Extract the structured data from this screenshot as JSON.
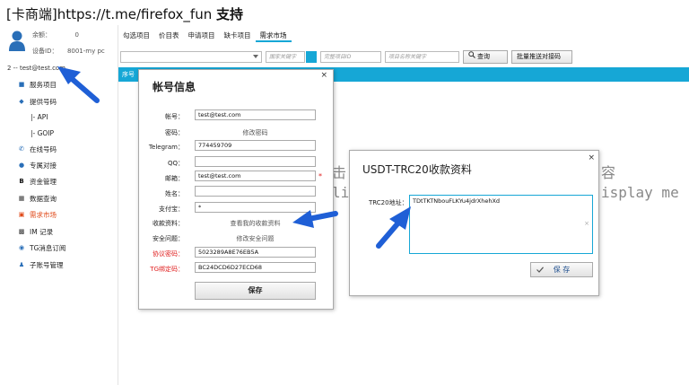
{
  "app": {
    "title_prefix": "[卡商端]",
    "title_url": "https://t.me/firefox_fun",
    "title_suffix": "支持"
  },
  "account": {
    "balance_label": "余额：",
    "balance_value": "0",
    "device_label": "设备ID：",
    "device_value": "8001-my pc",
    "user_line": "2 -- test@test.com"
  },
  "sidebar": {
    "items": [
      {
        "label": "服务项目",
        "icon": "shield-icon"
      },
      {
        "label": "提供号码",
        "icon": "diamond-icon"
      },
      {
        "label": "|- API",
        "icon": ""
      },
      {
        "label": "|- GOIP",
        "icon": ""
      },
      {
        "label": "在线号码",
        "icon": "phone-icon"
      },
      {
        "label": "专属对接",
        "icon": "link-icon"
      },
      {
        "label": "资金管理",
        "icon": "bitcoin-icon"
      },
      {
        "label": "数据查询",
        "icon": "grid-icon"
      },
      {
        "label": "需求市场",
        "icon": "market-icon"
      },
      {
        "label": "IM 记录",
        "icon": "chat-icon"
      },
      {
        "label": "TG消息订阅",
        "icon": "rss-icon"
      },
      {
        "label": "子账号管理",
        "icon": "user-icon"
      }
    ]
  },
  "tabs": [
    {
      "label": "勾选项目"
    },
    {
      "label": "价目表"
    },
    {
      "label": "申请项目"
    },
    {
      "label": "缺卡项目"
    },
    {
      "label": "需求市场"
    }
  ],
  "toolbar": {
    "country_placeholder": "国家关键字",
    "number_placeholder": "完整项目ID",
    "project_placeholder": "项目名称关键字",
    "search_label": "查询",
    "batch_label": "批量推送对接码"
  },
  "grid": {
    "col_index": "序号",
    "bg_text_1": "击",
    "bg_text_2": "li",
    "bg_text_3": "容",
    "bg_text_4": "isplay me"
  },
  "account_dialog": {
    "title": "帐号信息",
    "close": "×",
    "fields": {
      "account_label": "帐号：",
      "account_value": "test@test.com",
      "password_label": "密码：",
      "password_link": "修改密码",
      "telegram_label": "Telegram：",
      "telegram_value": "774459709",
      "qq_label": "QQ：",
      "qq_value": "",
      "email_label": "邮箱：",
      "email_value": "test@test.com",
      "email_star": "*",
      "name_label": "姓名：",
      "name_value": "",
      "alipay_label": "支付宝：",
      "alipay_value": "*",
      "collect_label": "收款资料：",
      "collect_link": "查看我的收款资料",
      "security_label": "安全问题：",
      "security_link": "修改安全问题",
      "protocol_label": "协议密码：",
      "protocol_value": "5023289A8E76EB5A",
      "tg_label": "TG绑定码：",
      "tg_value": "BC24DCD6D27ECD68"
    },
    "save_label": "保存"
  },
  "usdt_dialog": {
    "title": "USDT-TRC20收款资料",
    "close": "×",
    "address_label": "TRC20地址：",
    "address_value": "TDtTKTNbouFLKYu4jdrXhehXd",
    "clear_glyph": "×",
    "save_label": "保 存"
  },
  "colors": {
    "accent": "#16a7d6",
    "active_text": "#e04a1a",
    "required": "#e02020",
    "arrow": "#1f5fd6"
  }
}
